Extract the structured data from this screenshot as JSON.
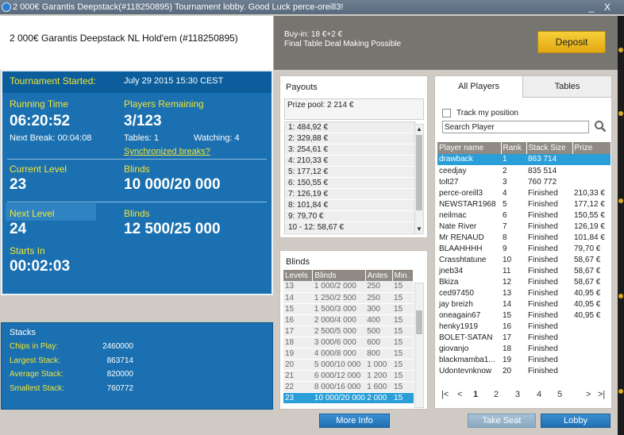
{
  "window": {
    "title": "2 000€ Garantis Deepstack(#118250895) Tournament lobby. Good Luck perce-oreill3!",
    "minimize": "_",
    "close": "X"
  },
  "header": {
    "tournament_name": "2 000€ Garantis Deepstack NL Hold'em (#118250895)",
    "buy_in": "Buy-in: 18 €+2 €",
    "deal_note": "Final Table Deal Making Possible",
    "deposit_label": "Deposit"
  },
  "info": {
    "started_label": "Tournament Started:",
    "started_value": "July 29 2015   15:30 CEST",
    "running_time_label": "Running Time",
    "running_time": "06:20:52",
    "players_remaining_label": "Players Remaining",
    "players_remaining": "3/123",
    "next_break": "Next Break: 00:04:08",
    "tables": "Tables: 1",
    "watching": "Watching: 4",
    "sync_breaks": "Synchronized breaks?",
    "current_level_label": "Current Level",
    "current_level": "23",
    "blinds_label": "Blinds",
    "current_blinds": "10 000/20 000",
    "next_level_label": "Next Level",
    "next_level": "24",
    "next_blinds_label": "Blinds",
    "next_blinds": "12 500/25 000",
    "starts_in_label": "Starts In",
    "starts_in": "00:02:03"
  },
  "stacks": {
    "title": "Stacks",
    "chips_label": "Chips in Play:",
    "chips": "2460000",
    "largest_label": "Largest Stack:",
    "largest": "863714",
    "average_label": "Average Stack:",
    "average": "820000",
    "smallest_label": "Smallest Stack:",
    "smallest": "760772"
  },
  "payouts": {
    "title": "Payouts",
    "prize_pool": "Prize pool: 2 214 €",
    "rows": [
      "1: 484,92 €",
      "2: 329,88 €",
      "3: 254,61 €",
      "4: 210,33 €",
      "5: 177,12 €",
      "6: 150,55 €",
      "7: 126,19 €",
      "8: 101,84 €",
      "9: 79,70 €",
      "10 - 12: 58,67 €"
    ]
  },
  "blinds": {
    "title": "Blinds",
    "headers": [
      "Levels",
      "Blinds",
      "Antes",
      "Min."
    ],
    "rows": [
      [
        "13",
        "1 000/2 000",
        "250",
        "15"
      ],
      [
        "14",
        "1 250/2 500",
        "250",
        "15"
      ],
      [
        "15",
        "1 500/3 000",
        "300",
        "15"
      ],
      [
        "16",
        "2 000/4 000",
        "400",
        "15"
      ],
      [
        "17",
        "2 500/5 000",
        "500",
        "15"
      ],
      [
        "18",
        "3 000/6 000",
        "600",
        "15"
      ],
      [
        "19",
        "4 000/8 000",
        "800",
        "15"
      ],
      [
        "20",
        "5 000/10 000",
        "1 000",
        "15"
      ],
      [
        "21",
        "6 000/12 000",
        "1 200",
        "15"
      ],
      [
        "22",
        "8 000/16 000",
        "1 600",
        "15"
      ],
      [
        "23",
        "10 000/20 000",
        "2 000",
        "15"
      ]
    ]
  },
  "players": {
    "tab_all": "All Players",
    "tab_tables": "Tables",
    "track_label": "Track my position",
    "search_placeholder": "Search Player",
    "headers": [
      "Player name",
      "Rank",
      "Stack Size",
      "Prize"
    ],
    "rows": [
      [
        "drawback",
        "1",
        "863 714",
        ""
      ],
      [
        "ceedjay",
        "2",
        "835 514",
        ""
      ],
      [
        "tolt27",
        "3",
        "760 772",
        ""
      ],
      [
        "perce-oreill3",
        "4",
        "Finished",
        "210,33 €"
      ],
      [
        "NEWSTAR1968",
        "5",
        "Finished",
        "177,12 €"
      ],
      [
        "neilmac",
        "6",
        "Finished",
        "150,55 €"
      ],
      [
        "Nate River",
        "7",
        "Finished",
        "126,19 €"
      ],
      [
        "Mr RENAUD",
        "8",
        "Finished",
        "101,84 €"
      ],
      [
        "BLAAHHHH",
        "9",
        "Finished",
        "79,70 €"
      ],
      [
        "Crasshtatune",
        "10",
        "Finished",
        "58,67 €"
      ],
      [
        "jneb34",
        "11",
        "Finished",
        "58,67 €"
      ],
      [
        "Bkiza",
        "12",
        "Finished",
        "58,67 €"
      ],
      [
        "ced97450",
        "13",
        "Finished",
        "40,95 €"
      ],
      [
        "jay breizh",
        "14",
        "Finished",
        "40,95 €"
      ],
      [
        "oneagain67",
        "15",
        "Finished",
        "40,95 €"
      ],
      [
        "henky1919",
        "16",
        "Finished",
        ""
      ],
      [
        "BOLET-SATAN",
        "17",
        "Finished",
        ""
      ],
      [
        "giovanjo",
        "18",
        "Finished",
        ""
      ],
      [
        "blackmamba1...",
        "19",
        "Finished",
        ""
      ],
      [
        "Udontevnknow",
        "20",
        "Finished",
        ""
      ]
    ],
    "pages": [
      "1",
      "2",
      "3",
      "4",
      "5"
    ],
    "current_page": "1"
  },
  "buttons": {
    "more_info": "More Info",
    "take_seat": "Take Seat",
    "lobby": "Lobby"
  },
  "colors": {
    "panel_blue": "#1a70b0",
    "label_yellow": "#f2e535",
    "selection_blue": "#2a9ed8",
    "deposit_gold": "#e2a811"
  }
}
